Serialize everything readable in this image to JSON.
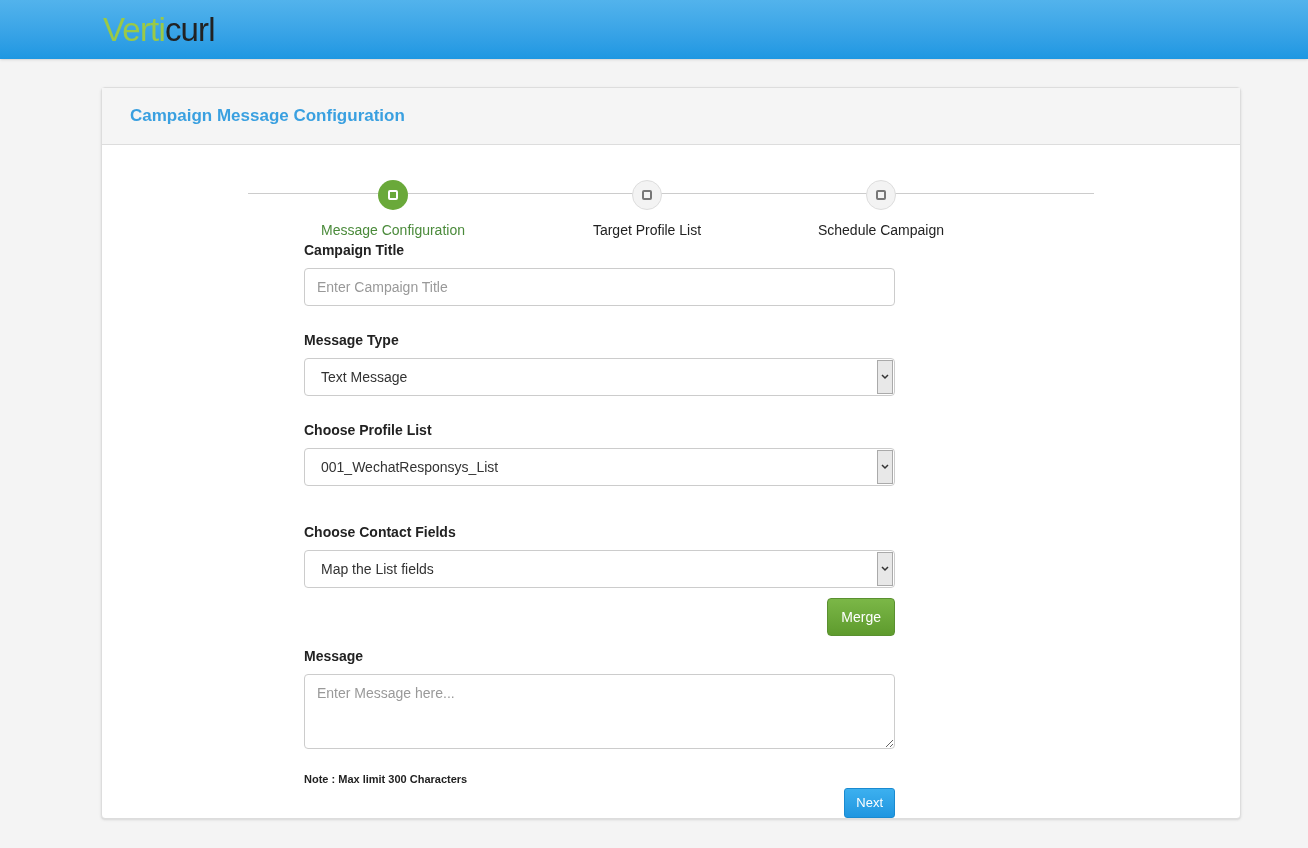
{
  "header": {
    "logo_first": "Verti",
    "logo_second": "curl"
  },
  "card": {
    "title": "Campaign Message Configuration"
  },
  "steps": [
    {
      "label": "Message Configuration",
      "selected": true
    },
    {
      "label": "Target Profile List",
      "selected": false
    },
    {
      "label": "Schedule Campaign",
      "selected": false
    }
  ],
  "fields": [
    {
      "kind": "text",
      "label": "Campaign Title",
      "placeholder": "Enter Campaign Title"
    },
    {
      "kind": "select",
      "label": "Message Type",
      "value": "Text Message"
    },
    {
      "kind": "select",
      "label": "Choose Profile List",
      "value": "001_WechatResponsys_List"
    },
    {
      "kind": "select",
      "label": "Choose Contact Fields",
      "value": "Map the List fields",
      "button": "Merge"
    },
    {
      "kind": "textarea",
      "label": "Message",
      "placeholder": "Enter Message here..."
    }
  ],
  "note": "Note : Max limit 300 Characters",
  "next_button": "Next"
}
